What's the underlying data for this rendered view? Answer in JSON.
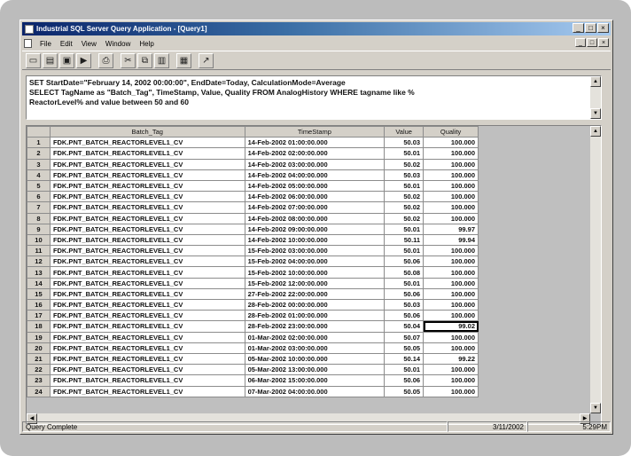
{
  "window": {
    "title": "Industrial SQL Server Query Application - [Query1]",
    "buttons": {
      "minimize": "_",
      "maximize": "□",
      "close": "×"
    }
  },
  "menu": {
    "items": [
      "File",
      "Edit",
      "View",
      "Window",
      "Help"
    ]
  },
  "toolbar": {
    "buttons": [
      {
        "name": "new-query",
        "glyph": "▭"
      },
      {
        "name": "open-query",
        "glyph": "▤"
      },
      {
        "name": "save-query",
        "glyph": "▣"
      },
      {
        "name": "execute",
        "glyph": "▶"
      },
      {
        "name": "print",
        "glyph": "⎙"
      },
      {
        "name": "cut",
        "glyph": "✂"
      },
      {
        "name": "copy",
        "glyph": "⧉"
      },
      {
        "name": "paste",
        "glyph": "▥"
      },
      {
        "name": "tile",
        "glyph": "▦"
      },
      {
        "name": "chart",
        "glyph": "↗"
      }
    ]
  },
  "query": {
    "line1": "SET StartDate=\"February 14, 2002 00:00:00\", EndDate=Today, CalculationMode=Average",
    "line2": "SELECT TagName as \"Batch_Tag\", TimeStamp, Value, Quality FROM AnalogHistory WHERE tagname like %",
    "line3": "ReactorLevel% and value between 50 and 60"
  },
  "grid": {
    "columns": [
      "Batch_Tag",
      "TimeStamp",
      "Value",
      "Quality"
    ],
    "rows": [
      {
        "n": "1",
        "tag": "FDK.PNT_BATCH_REACTORLEVEL1_CV",
        "ts": "14-Feb-2002 01:00:00.000",
        "value": "50.03",
        "quality": "100.000"
      },
      {
        "n": "2",
        "tag": "FDK.PNT_BATCH_REACTORLEVEL1_CV",
        "ts": "14-Feb-2002 02:00:00.000",
        "value": "50.01",
        "quality": "100.000"
      },
      {
        "n": "3",
        "tag": "FDK.PNT_BATCH_REACTORLEVEL1_CV",
        "ts": "14-Feb-2002 03:00:00.000",
        "value": "50.02",
        "quality": "100.000"
      },
      {
        "n": "4",
        "tag": "FDK.PNT_BATCH_REACTORLEVEL1_CV",
        "ts": "14-Feb-2002 04:00:00.000",
        "value": "50.03",
        "quality": "100.000"
      },
      {
        "n": "5",
        "tag": "FDK.PNT_BATCH_REACTORLEVEL1_CV",
        "ts": "14-Feb-2002 05:00:00.000",
        "value": "50.01",
        "quality": "100.000"
      },
      {
        "n": "6",
        "tag": "FDK.PNT_BATCH_REACTORLEVEL1_CV",
        "ts": "14-Feb-2002 06:00:00.000",
        "value": "50.02",
        "quality": "100.000"
      },
      {
        "n": "7",
        "tag": "FDK.PNT_BATCH_REACTORLEVEL1_CV",
        "ts": "14-Feb-2002 07:00:00.000",
        "value": "50.02",
        "quality": "100.000"
      },
      {
        "n": "8",
        "tag": "FDK.PNT_BATCH_REACTORLEVEL1_CV",
        "ts": "14-Feb-2002 08:00:00.000",
        "value": "50.02",
        "quality": "100.000"
      },
      {
        "n": "9",
        "tag": "FDK.PNT_BATCH_REACTORLEVEL1_CV",
        "ts": "14-Feb-2002 09:00:00.000",
        "value": "50.01",
        "quality": "99.97"
      },
      {
        "n": "10",
        "tag": "FDK.PNT_BATCH_REACTORLEVEL1_CV",
        "ts": "14-Feb-2002 10:00:00.000",
        "value": "50.11",
        "quality": "99.94"
      },
      {
        "n": "11",
        "tag": "FDK.PNT_BATCH_REACTORLEVEL1_CV",
        "ts": "15-Feb-2002 03:00:00.000",
        "value": "50.01",
        "quality": "100.000"
      },
      {
        "n": "12",
        "tag": "FDK.PNT_BATCH_REACTORLEVEL1_CV",
        "ts": "15-Feb-2002 04:00:00.000",
        "value": "50.06",
        "quality": "100.000"
      },
      {
        "n": "13",
        "tag": "FDK.PNT_BATCH_REACTORLEVEL1_CV",
        "ts": "15-Feb-2002 10:00:00.000",
        "value": "50.08",
        "quality": "100.000"
      },
      {
        "n": "14",
        "tag": "FDK.PNT_BATCH_REACTORLEVEL1_CV",
        "ts": "15-Feb-2002 12:00:00.000",
        "value": "50.01",
        "quality": "100.000"
      },
      {
        "n": "15",
        "tag": "FDK.PNT_BATCH_REACTORLEVEL1_CV",
        "ts": "27-Feb-2002 22:00:00.000",
        "value": "50.06",
        "quality": "100.000"
      },
      {
        "n": "16",
        "tag": "FDK.PNT_BATCH_REACTORLEVEL1_CV",
        "ts": "28-Feb-2002 00:00:00.000",
        "value": "50.03",
        "quality": "100.000"
      },
      {
        "n": "17",
        "tag": "FDK.PNT_BATCH_REACTORLEVEL1_CV",
        "ts": "28-Feb-2002 01:00:00.000",
        "value": "50.06",
        "quality": "100.000"
      },
      {
        "n": "18",
        "tag": "FDK.PNT_BATCH_REACTORLEVEL1_CV",
        "ts": "28-Feb-2002 23:00:00.000",
        "value": "50.04",
        "quality": "99.02"
      },
      {
        "n": "19",
        "tag": "FDK.PNT_BATCH_REACTORLEVEL1_CV",
        "ts": "01-Mar-2002 02:00:00.000",
        "value": "50.07",
        "quality": "100.000"
      },
      {
        "n": "20",
        "tag": "FDK.PNT_BATCH_REACTORLEVEL1_CV",
        "ts": "01-Mar-2002 03:00:00.000",
        "value": "50.05",
        "quality": "100.000"
      },
      {
        "n": "21",
        "tag": "FDK.PNT_BATCH_REACTORLEVEL1_CV",
        "ts": "05-Mar-2002 10:00:00.000",
        "value": "50.14",
        "quality": "99.22"
      },
      {
        "n": "22",
        "tag": "FDK.PNT_BATCH_REACTORLEVEL1_CV",
        "ts": "05-Mar-2002 13:00:00.000",
        "value": "50.01",
        "quality": "100.000"
      },
      {
        "n": "23",
        "tag": "FDK.PNT_BATCH_REACTORLEVEL1_CV",
        "ts": "06-Mar-2002 15:00:00.000",
        "value": "50.06",
        "quality": "100.000"
      },
      {
        "n": "24",
        "tag": "FDK.PNT_BATCH_REACTORLEVEL1_CV",
        "ts": "07-Mar-2002 04:00:00.000",
        "value": "50.05",
        "quality": "100.000"
      }
    ]
  },
  "status": {
    "left": "Query Complete",
    "date": "3/11/2002",
    "time": "5:29PM"
  }
}
